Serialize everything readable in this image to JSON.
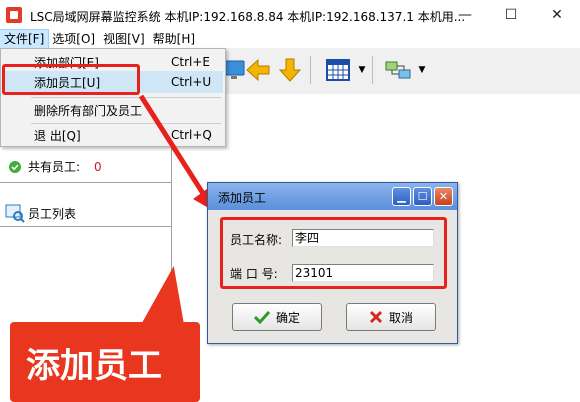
{
  "window": {
    "title": "LSC局域网屏幕监控系统    本机IP:192.168.8.84   本机IP:192.168.137.1     本机用...",
    "minimize": "—",
    "maximize": "☐",
    "close": "✕"
  },
  "menubar": {
    "items": [
      {
        "label": "文件[F]"
      },
      {
        "label": "选项[O]"
      },
      {
        "label": "视图[V]"
      },
      {
        "label": "帮助[H]"
      }
    ]
  },
  "file_menu": {
    "items": [
      {
        "label": "添加部门[E]",
        "shortcut": "Ctrl+E"
      },
      {
        "label": "添加员工[U]",
        "shortcut": "Ctrl+U"
      },
      {
        "label": "删除所有部门及员工",
        "shortcut": ""
      },
      {
        "label": "退 出[Q]",
        "shortcut": "Ctrl+Q"
      }
    ]
  },
  "left_pane": {
    "total_label": "共有员工:",
    "total_count": "0",
    "list_label": "员工列表"
  },
  "dialog": {
    "title": "添加员工",
    "name_label": "员工名称:",
    "name_value": "李四",
    "port_label": "端 口 号:",
    "port_value": "23101",
    "ok_label": "确定",
    "cancel_label": "取消"
  },
  "callout": {
    "text": "添加员工"
  },
  "colors": {
    "annotation_red": "#e8211d",
    "dialog_title": "#5b8fdc",
    "menu_highlight": "#cfe6f7"
  },
  "icons": [
    "app-icon",
    "monitor-icon",
    "arrow-left-icon",
    "arrow-down-icon",
    "calendar-grid-icon",
    "network-switch-icon",
    "check-icon",
    "cross-icon",
    "employee-list-icon"
  ]
}
